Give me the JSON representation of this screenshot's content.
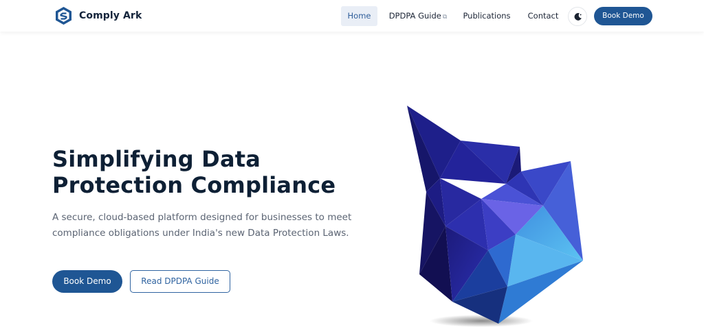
{
  "brand": {
    "name": "Comply Ark",
    "logo_icon": "hexagon-shield-logo-icon"
  },
  "nav": {
    "home": "Home",
    "guide": "DPDPA Guide",
    "guide_icon": "external-link-icon",
    "publications": "Publications",
    "contact": "Contact",
    "theme_icon": "moon-icon",
    "cta": "Book Demo"
  },
  "hero": {
    "title_line1": "Simplifying Data",
    "title_line2": "Protection Compliance",
    "subtitle": "A secure, cloud-based platform designed for businesses to meet compliance obligations under India's new Data Protection Laws.",
    "primary_cta": "Book Demo",
    "secondary_cta": "Read DPDPA Guide",
    "illustration": "low-poly-crystal-illustration"
  },
  "colors": {
    "primary": "#1f5694",
    "heading": "#0e2035",
    "text_muted": "#5b6473",
    "nav_active_bg": "#e9eef6"
  }
}
